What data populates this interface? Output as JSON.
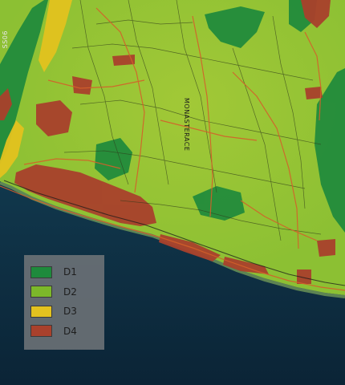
{
  "map": {
    "place_labels": {
      "main_road": "MONASTERACE",
      "edge_fragment": "SS06"
    },
    "legend": {
      "items": [
        {
          "label": "D1",
          "color": "#1e8a3c"
        },
        {
          "label": "D2",
          "color": "#7cb82a"
        },
        {
          "label": "D3",
          "color": "#e3c21f"
        },
        {
          "label": "D4",
          "color": "#a9412c"
        }
      ]
    },
    "colors": {
      "sea": "#0b2436",
      "sea_shallow": "#1d5a6a",
      "land_base": "#8cc033",
      "zone_dark": "#1e8a3c",
      "zone_yellow": "#e3c21f",
      "zone_red": "#a9412c",
      "road": "#d4602a",
      "parcel": "#2f3a1a"
    }
  }
}
